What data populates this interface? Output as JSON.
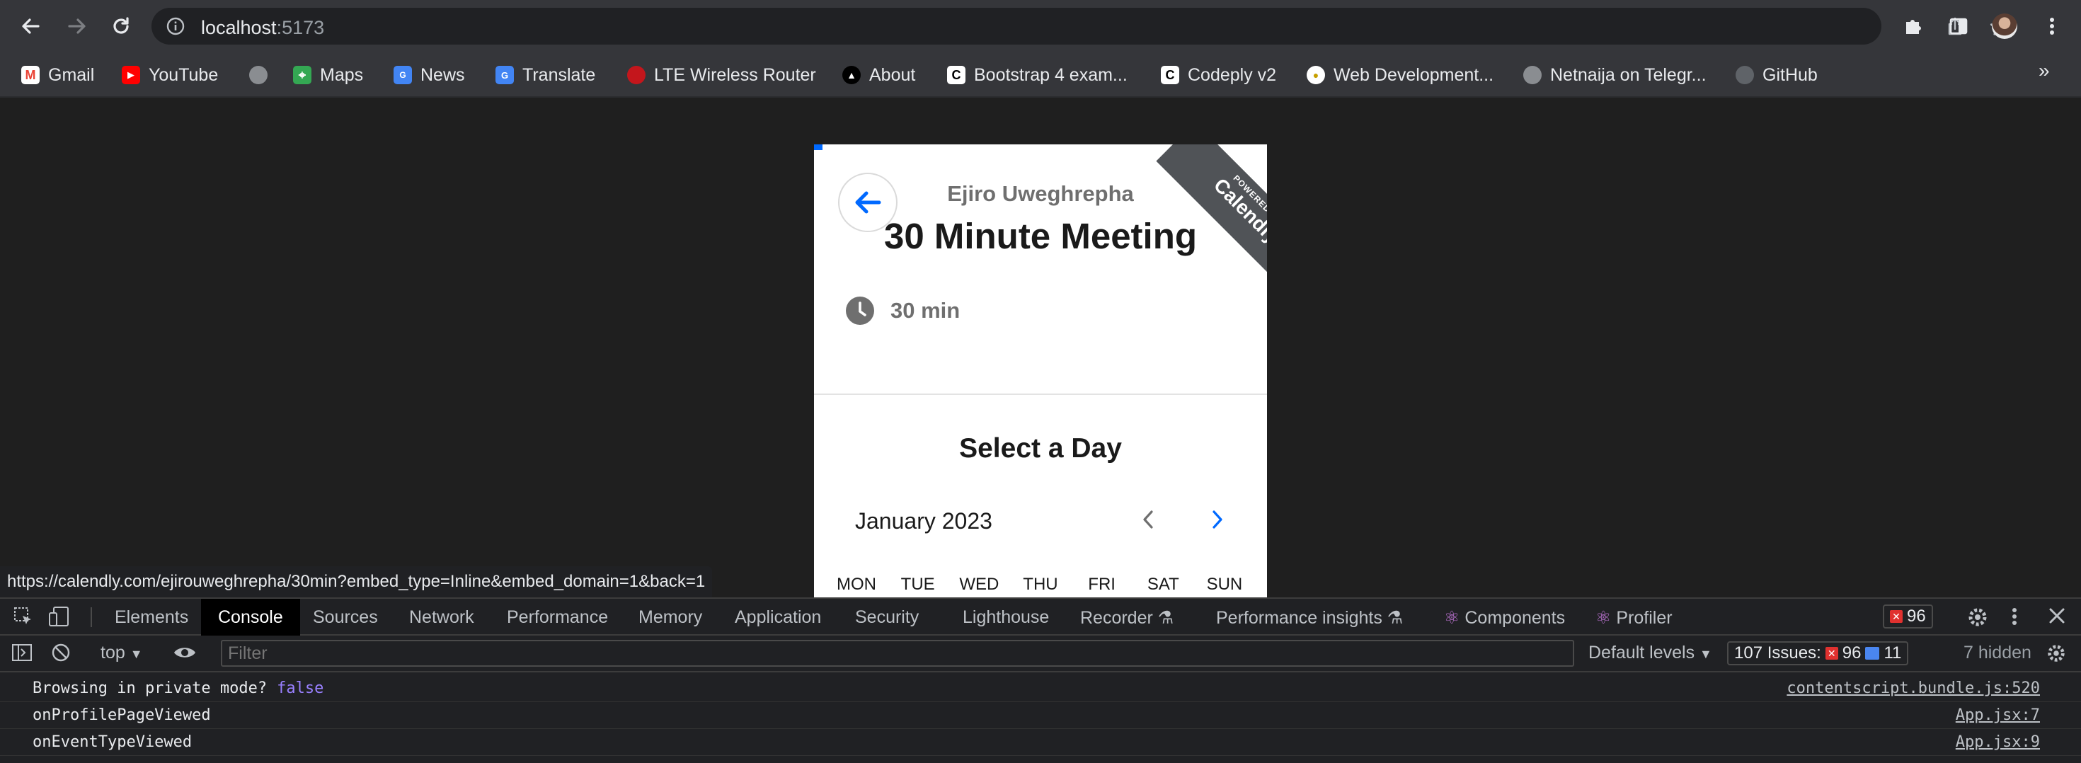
{
  "browser": {
    "url_host": "localhost",
    "url_port": ":5173",
    "bookmarks": [
      {
        "label": "Gmail",
        "icon": "gmail-icon"
      },
      {
        "label": "YouTube",
        "icon": "youtube-icon"
      },
      {
        "label": "",
        "icon": "globe-icon"
      },
      {
        "label": "Maps",
        "icon": "maps-icon"
      },
      {
        "label": "News",
        "icon": "news-icon"
      },
      {
        "label": "Translate",
        "icon": "translate-icon"
      },
      {
        "label": "LTE Wireless Router",
        "icon": "router-icon"
      },
      {
        "label": "About",
        "icon": "about-icon"
      },
      {
        "label": "Bootstrap 4 exam...",
        "icon": "codeply-icon"
      },
      {
        "label": "Codeply v2",
        "icon": "codeply-icon"
      },
      {
        "label": "Web Development...",
        "icon": "bookmark-icon"
      },
      {
        "label": "Netnaija on Telegr...",
        "icon": "globe-icon"
      },
      {
        "label": "GitHub",
        "icon": "github-icon"
      }
    ],
    "more_label": "»",
    "status_url": "https://calendly.com/ejirouweghrepha/30min?embed_type=Inline&embed_domain=1&back=1"
  },
  "calendly": {
    "host_name": "Ejiro Uweghrepha",
    "meeting_title": "30 Minute Meeting",
    "duration": "30 min",
    "select_day": "Select a Day",
    "month": "January 2023",
    "weekdays": [
      "MON",
      "TUE",
      "WED",
      "THU",
      "FRI",
      "SAT",
      "SUN"
    ],
    "ribbon_small": "POWERED BY",
    "ribbon_big": "Calendly",
    "colors": {
      "accent": "#0069ff",
      "ribbon": "#505357"
    }
  },
  "devtools": {
    "tabs": [
      "Elements",
      "Console",
      "Sources",
      "Network",
      "Performance",
      "Memory",
      "Application",
      "Security",
      "Lighthouse",
      "Recorder",
      "Performance insights",
      "Components",
      "Profiler"
    ],
    "active_tab": "Console",
    "error_count": "96",
    "context": "top",
    "filter_placeholder": "Filter",
    "levels": "Default levels",
    "issues_label": "107 Issues:",
    "issues_errors": "96",
    "issues_info": "11",
    "hidden": "7 hidden",
    "logs": [
      {
        "message": "Browsing in private mode?",
        "value": "false",
        "source": "contentscript.bundle.js:520"
      },
      {
        "message": "onProfilePageViewed",
        "value": "",
        "source": "App.jsx:7"
      },
      {
        "message": "onEventTypeViewed",
        "value": "",
        "source": "App.jsx:9"
      }
    ]
  }
}
